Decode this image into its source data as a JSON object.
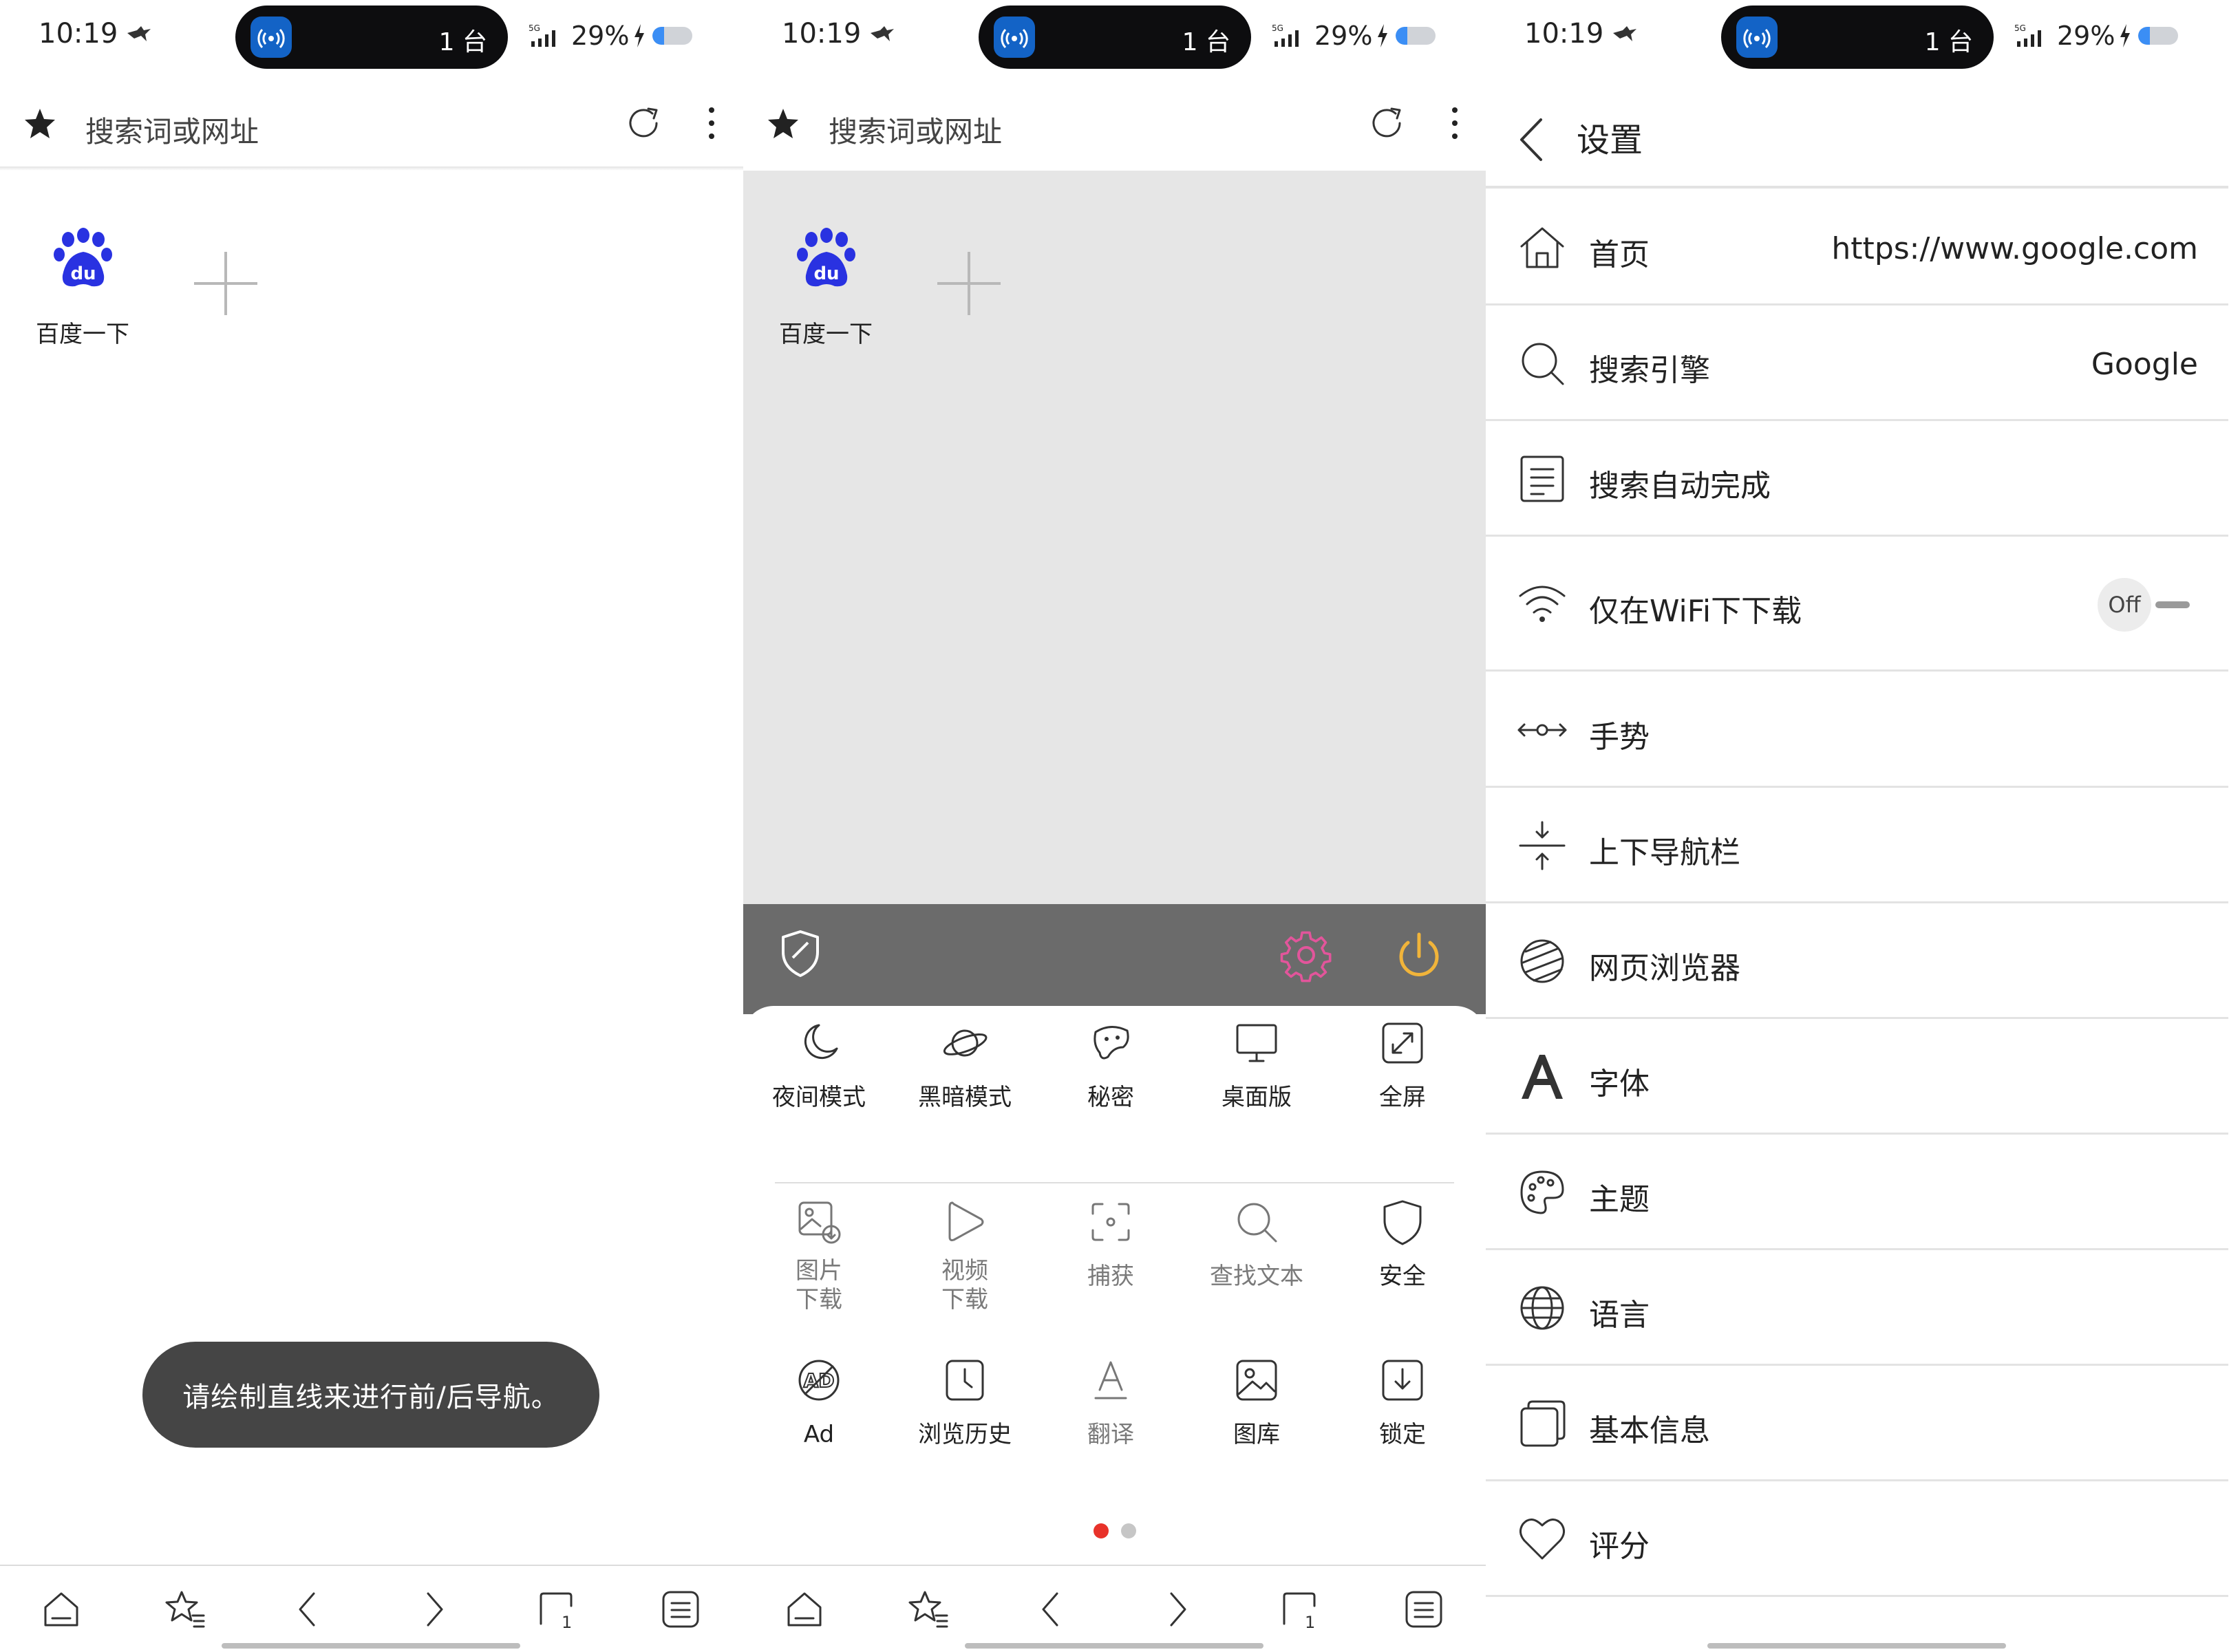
{
  "status_bar": {
    "time": "10:19",
    "live_count": "1 台",
    "network": "5G",
    "battery": "29%",
    "battery_level": 0.29
  },
  "browser": {
    "address_placeholder": "搜索词或网址",
    "speed_dial": [
      {
        "label": "百度一下",
        "logo_text": "du"
      }
    ],
    "toast": "请绘制直线来进行前/后导航。",
    "bottom_nav": {
      "tabs_count": "1"
    }
  },
  "menu": {
    "page1_row1": [
      "夜间模式",
      "黑暗模式",
      "秘密",
      "桌面版",
      "全屏"
    ],
    "page1_row2": [
      "图片\n下载",
      "视频\n下载",
      "捕获",
      "查找文本",
      "安全"
    ],
    "page1_row3": [
      "Ad",
      "浏览历史",
      "翻译",
      "图库",
      "锁定"
    ],
    "icons": {
      "shield": "shield-check-icon",
      "settings": "gear-icon",
      "power": "power-icon"
    },
    "colors": {
      "settings": "#e2559b",
      "power": "#f1b43a",
      "active_dot": "#e8322a"
    },
    "page_count": 2,
    "current_page": 1
  },
  "settings": {
    "title": "设置",
    "rows": [
      {
        "label": "首页",
        "value": "https://www.google.com",
        "icon": "home-icon"
      },
      {
        "label": "搜索引擎",
        "value": "Google",
        "icon": "search-icon"
      },
      {
        "label": "搜索自动完成",
        "value": "",
        "icon": "document-icon"
      },
      {
        "label": "仅在WiFi下下载",
        "toggle": "Off",
        "icon": "wifi-icon"
      },
      {
        "label": "手势",
        "value": "",
        "icon": "gesture-icon"
      },
      {
        "label": "上下导航栏",
        "value": "",
        "icon": "collapse-vertical-icon"
      },
      {
        "label": "网页浏览器",
        "value": "",
        "icon": "web-browser-icon"
      },
      {
        "label": "字体",
        "value": "",
        "icon": "font-icon"
      },
      {
        "label": "主题",
        "value": "",
        "icon": "palette-icon"
      },
      {
        "label": "语言",
        "value": "",
        "icon": "globe-icon"
      },
      {
        "label": "基本信息",
        "value": "",
        "icon": "info-stack-icon"
      },
      {
        "label": "评分",
        "value": "",
        "icon": "heart-icon"
      }
    ]
  }
}
